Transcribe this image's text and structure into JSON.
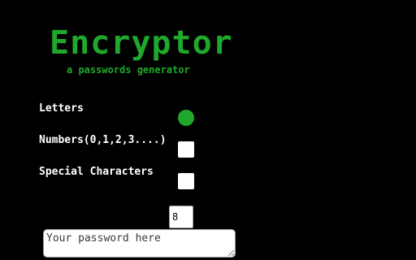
{
  "app": {
    "title": "Encryptor",
    "subtitle": "a passwords generator"
  },
  "options": {
    "letters_label": "Letters",
    "letters_selected": true,
    "numbers_label": "Numbers(0,1,2,3....)",
    "numbers_checked": false,
    "special_label": "Special Characters",
    "special_checked": false
  },
  "length": {
    "value": "8"
  },
  "output": {
    "placeholder": "Your password here",
    "value": ""
  },
  "colors": {
    "accent": "#1fa82c",
    "background": "#000000"
  }
}
